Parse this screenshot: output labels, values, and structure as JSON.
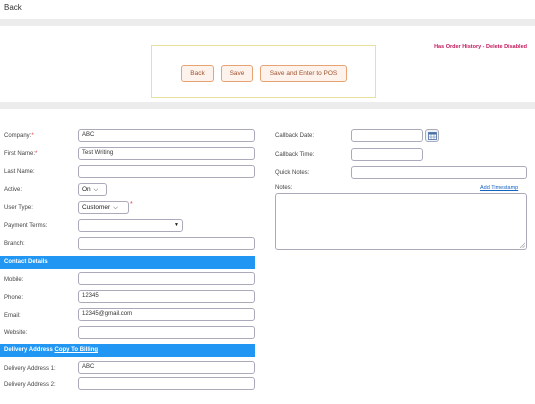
{
  "header": {
    "back_label": "Back"
  },
  "warning_text": "Has Order History - Delete Disabled",
  "actions": {
    "back": "Back",
    "save": "Save",
    "save_pos": "Save and Enter to POS"
  },
  "left_fields": {
    "company": {
      "label": "Company:",
      "required": "*",
      "value": "ABC"
    },
    "first_name": {
      "label": "First Name:",
      "required": "*",
      "value": "Test Writing"
    },
    "last_name": {
      "label": "Last Name:",
      "value": ""
    },
    "active": {
      "label": "Active:",
      "value": "On"
    },
    "user_type": {
      "label": "User Type:",
      "value": "Customer",
      "required": "*"
    },
    "payment_terms": {
      "label": "Payment Terms:",
      "value": ""
    },
    "branch": {
      "label": "Branch:",
      "value": ""
    }
  },
  "contact": {
    "title": "Contact Details",
    "mobile": {
      "label": "Mobile:",
      "value": ""
    },
    "phone": {
      "label": "Phone:",
      "value": "12345"
    },
    "email": {
      "label": "Email:",
      "value": "12345@gmail.com"
    },
    "website": {
      "label": "Website:",
      "value": ""
    }
  },
  "delivery": {
    "title": "Delivery Address",
    "copy_link": "Copy To Billing",
    "address1": {
      "label": "Delivery Address 1:",
      "value": "ABC"
    },
    "address2": {
      "label": "Delivery Address 2:",
      "value": ""
    }
  },
  "right_fields": {
    "callback_date": {
      "label": "Callback Date:",
      "value": ""
    },
    "callback_time": {
      "label": "Callback Time:",
      "value": ""
    },
    "quick_notes": {
      "label": "Quick Notes:",
      "value": ""
    },
    "notes": {
      "label": "Notes:",
      "value": ""
    },
    "add_timestamp": "Add Timestamp"
  },
  "icons": {
    "calendar": "calendar-icon",
    "dropdown": "chevron-down-icon",
    "resize": "resize-grip-icon"
  },
  "colors": {
    "section_bar": "#2196f3",
    "warning": "#c2185b",
    "button_border": "#e8a372"
  }
}
